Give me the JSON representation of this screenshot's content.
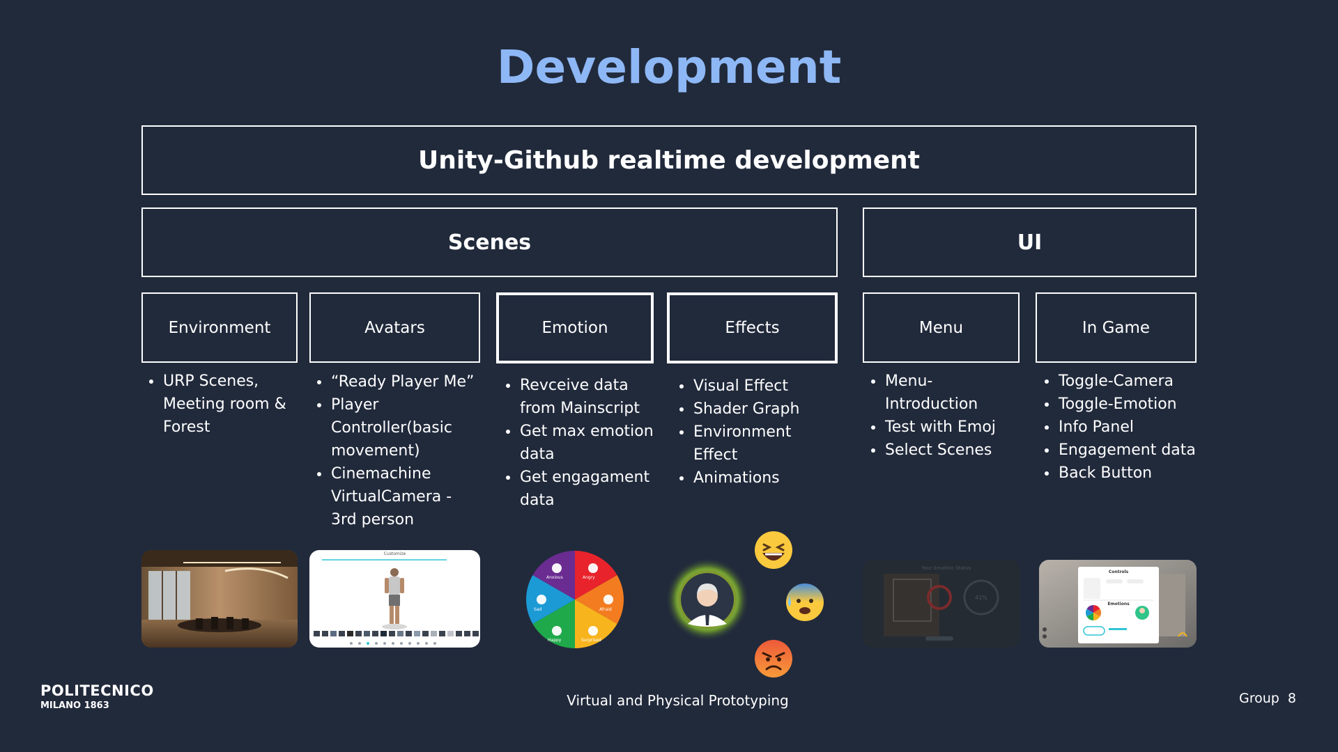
{
  "title": "Development",
  "header_box": "Unity-Github realtime development",
  "groups": {
    "scenes": "Scenes",
    "ui": "UI"
  },
  "columns": [
    {
      "label": "Environment",
      "items": [
        "URP Scenes, Meeting room & Forest"
      ]
    },
    {
      "label": "Avatars",
      "items": [
        "“Ready Player Me”",
        "Player Controller(basic movement)",
        "Cinemachine VirtualCamera - 3rd person"
      ]
    },
    {
      "label": "Emotion",
      "items": [
        "Revceive data from Mainscript",
        "Get max emotion data",
        "Get engagament data"
      ]
    },
    {
      "label": "Effects",
      "items": [
        "Visual Effect",
        "Shader Graph",
        "Environment Effect",
        "Animations"
      ]
    },
    {
      "label": "Menu",
      "items": [
        "Menu-Introduction",
        "Test with Emoj",
        "Select Scenes"
      ]
    },
    {
      "label": "In Game",
      "items": [
        "Toggle-Camera",
        "Toggle-Emotion",
        "Info Panel",
        "Engagement data",
        "Back Button"
      ]
    }
  ],
  "emotion_wheel": [
    "Angry",
    "Afraid",
    "Surprised",
    "Happy",
    "Sad",
    "Anxious"
  ],
  "thumb_text": {
    "avatar_header": "Customize",
    "menu_title": "Your Emotion Status",
    "menu_percent": "41%",
    "panel_title": "Controls",
    "panel_section": "Emotions"
  },
  "footer": {
    "logo_top": "POLITECNICO",
    "logo_bottom": "MILANO 1863",
    "course": "Virtual and Physical Prototyping",
    "group": "Group  8"
  },
  "colors": {
    "title": "#8db8f5",
    "background": "#212a3b"
  }
}
